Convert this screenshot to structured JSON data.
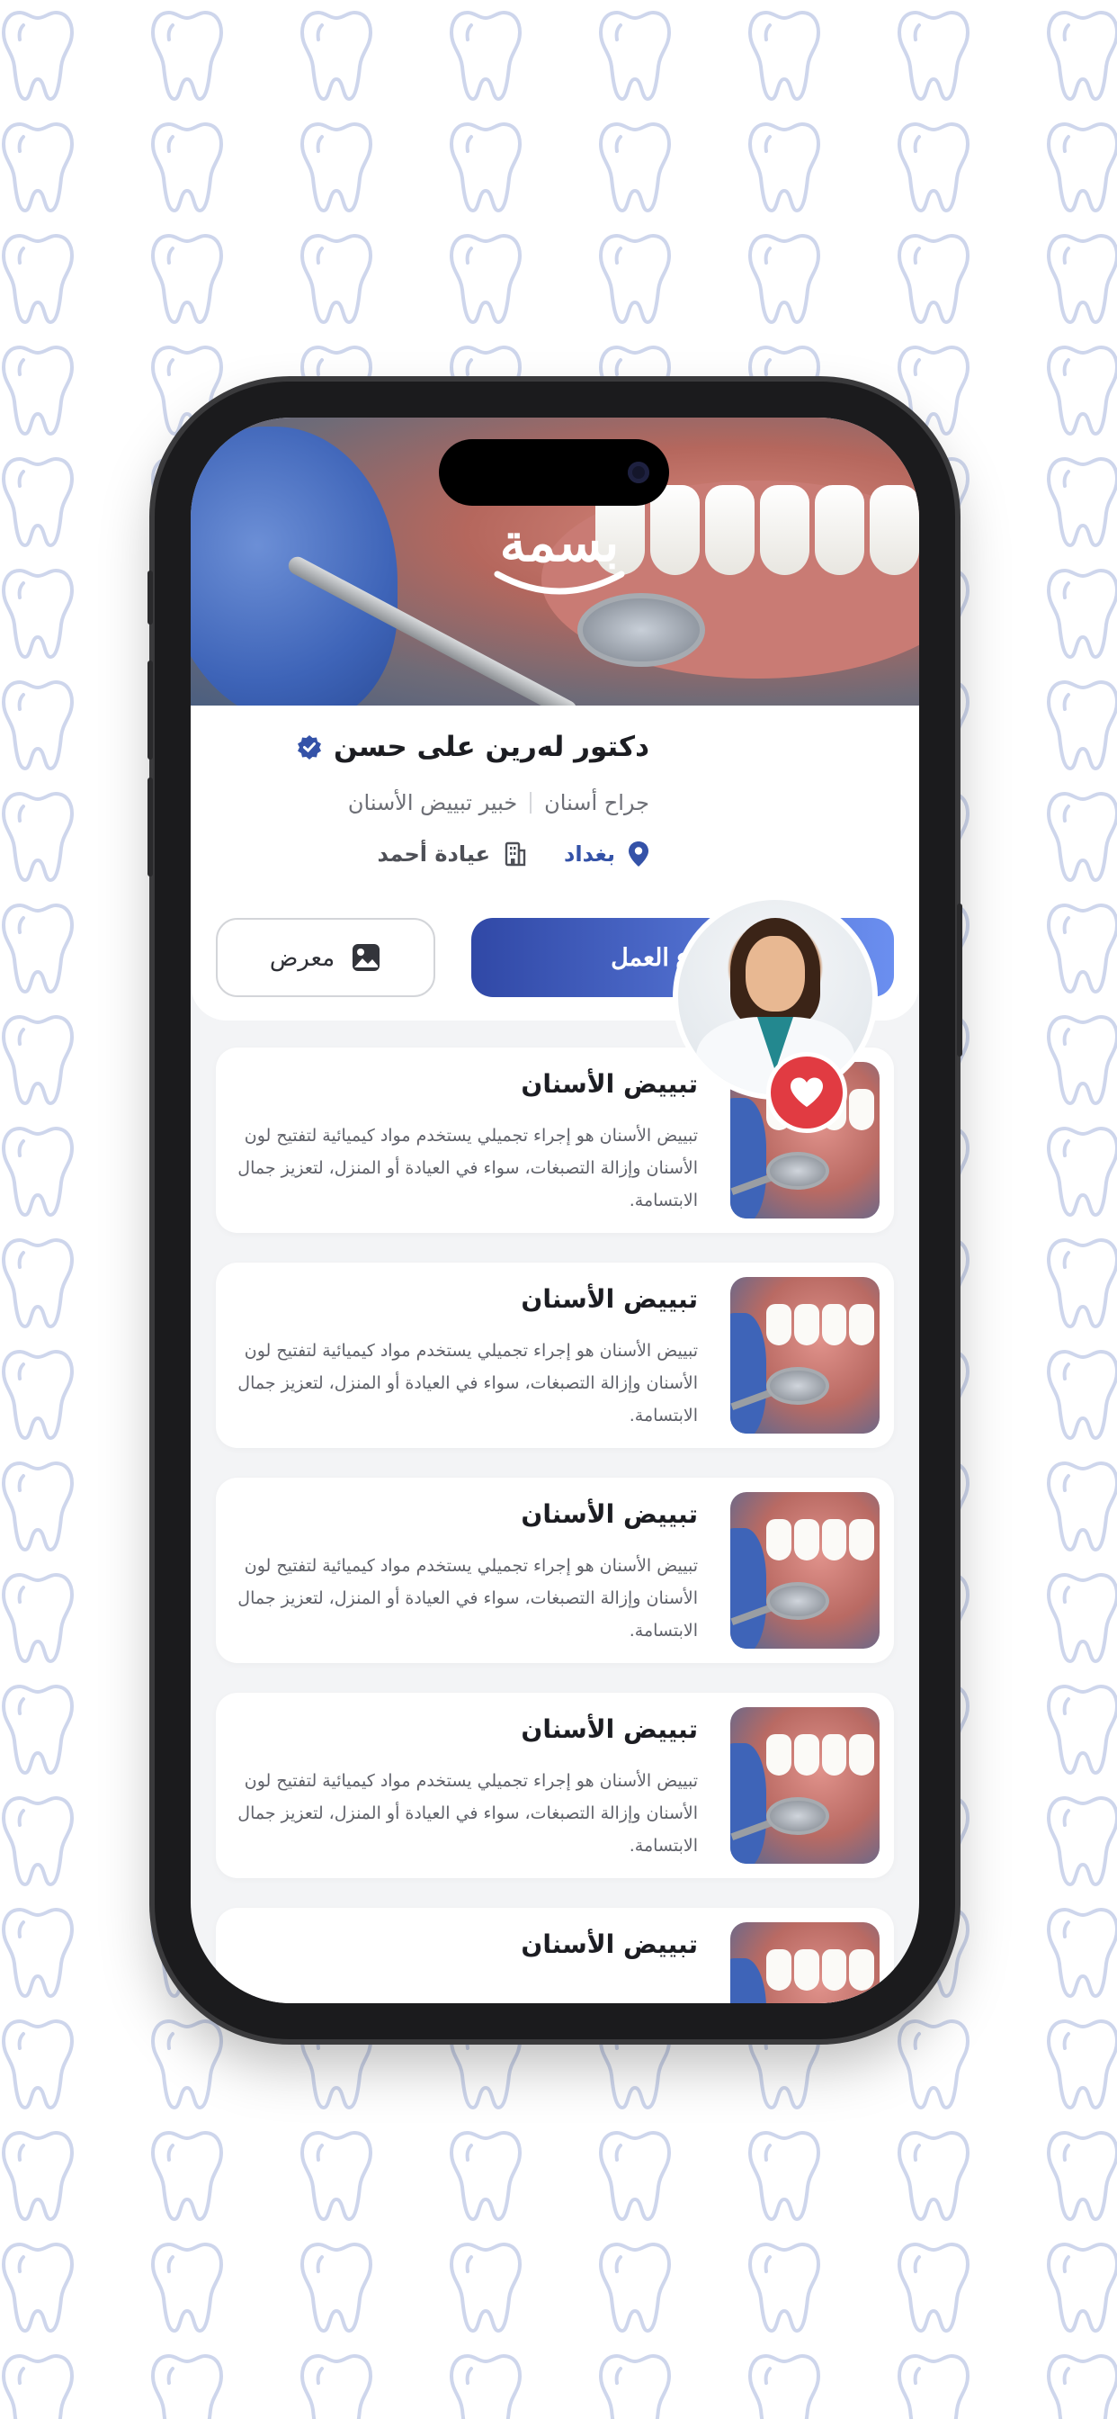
{
  "app": {
    "logo_text": "بسمة"
  },
  "doctor": {
    "name": "دكتور لەرين على حسن",
    "verified_icon": "verified-badge-icon",
    "specialty_primary": "جراح أسنان",
    "specialty_secondary": "خبير تبييض الأسنان",
    "city": "بغداد",
    "clinic": "عيادة أحمد"
  },
  "actions": {
    "primary_label": "نوع العمل",
    "secondary_label": "معرض"
  },
  "services": [
    {
      "title": "تبييض الأسنان",
      "description": "تبييض الأسنان هو إجراء تجميلي يستخدم مواد كيميائية لتفتيح لون الأسنان وإزالة التصبغات، سواء في العيادة أو المنزل، لتعزيز جمال الابتسامة."
    },
    {
      "title": "تبييض الأسنان",
      "description": "تبييض الأسنان هو إجراء تجميلي يستخدم مواد كيميائية لتفتيح لون الأسنان وإزالة التصبغات، سواء في العيادة أو المنزل، لتعزيز جمال الابتسامة."
    },
    {
      "title": "تبييض الأسنان",
      "description": "تبييض الأسنان هو إجراء تجميلي يستخدم مواد كيميائية لتفتيح لون الأسنان وإزالة التصبغات، سواء في العيادة أو المنزل، لتعزيز جمال الابتسامة."
    },
    {
      "title": "تبييض الأسنان",
      "description": "تبييض الأسنان هو إجراء تجميلي يستخدم مواد كيميائية لتفتيح لون الأسنان وإزالة التصبغات، سواء في العيادة أو المنزل، لتعزيز جمال الابتسامة."
    },
    {
      "title": "تبييض الأسنان",
      "description": ""
    }
  ],
  "colors": {
    "primary": "#3452a8",
    "gradient_end": "#6b8ff0",
    "favorite": "#e13b42",
    "pattern": "#c9d2ea"
  }
}
